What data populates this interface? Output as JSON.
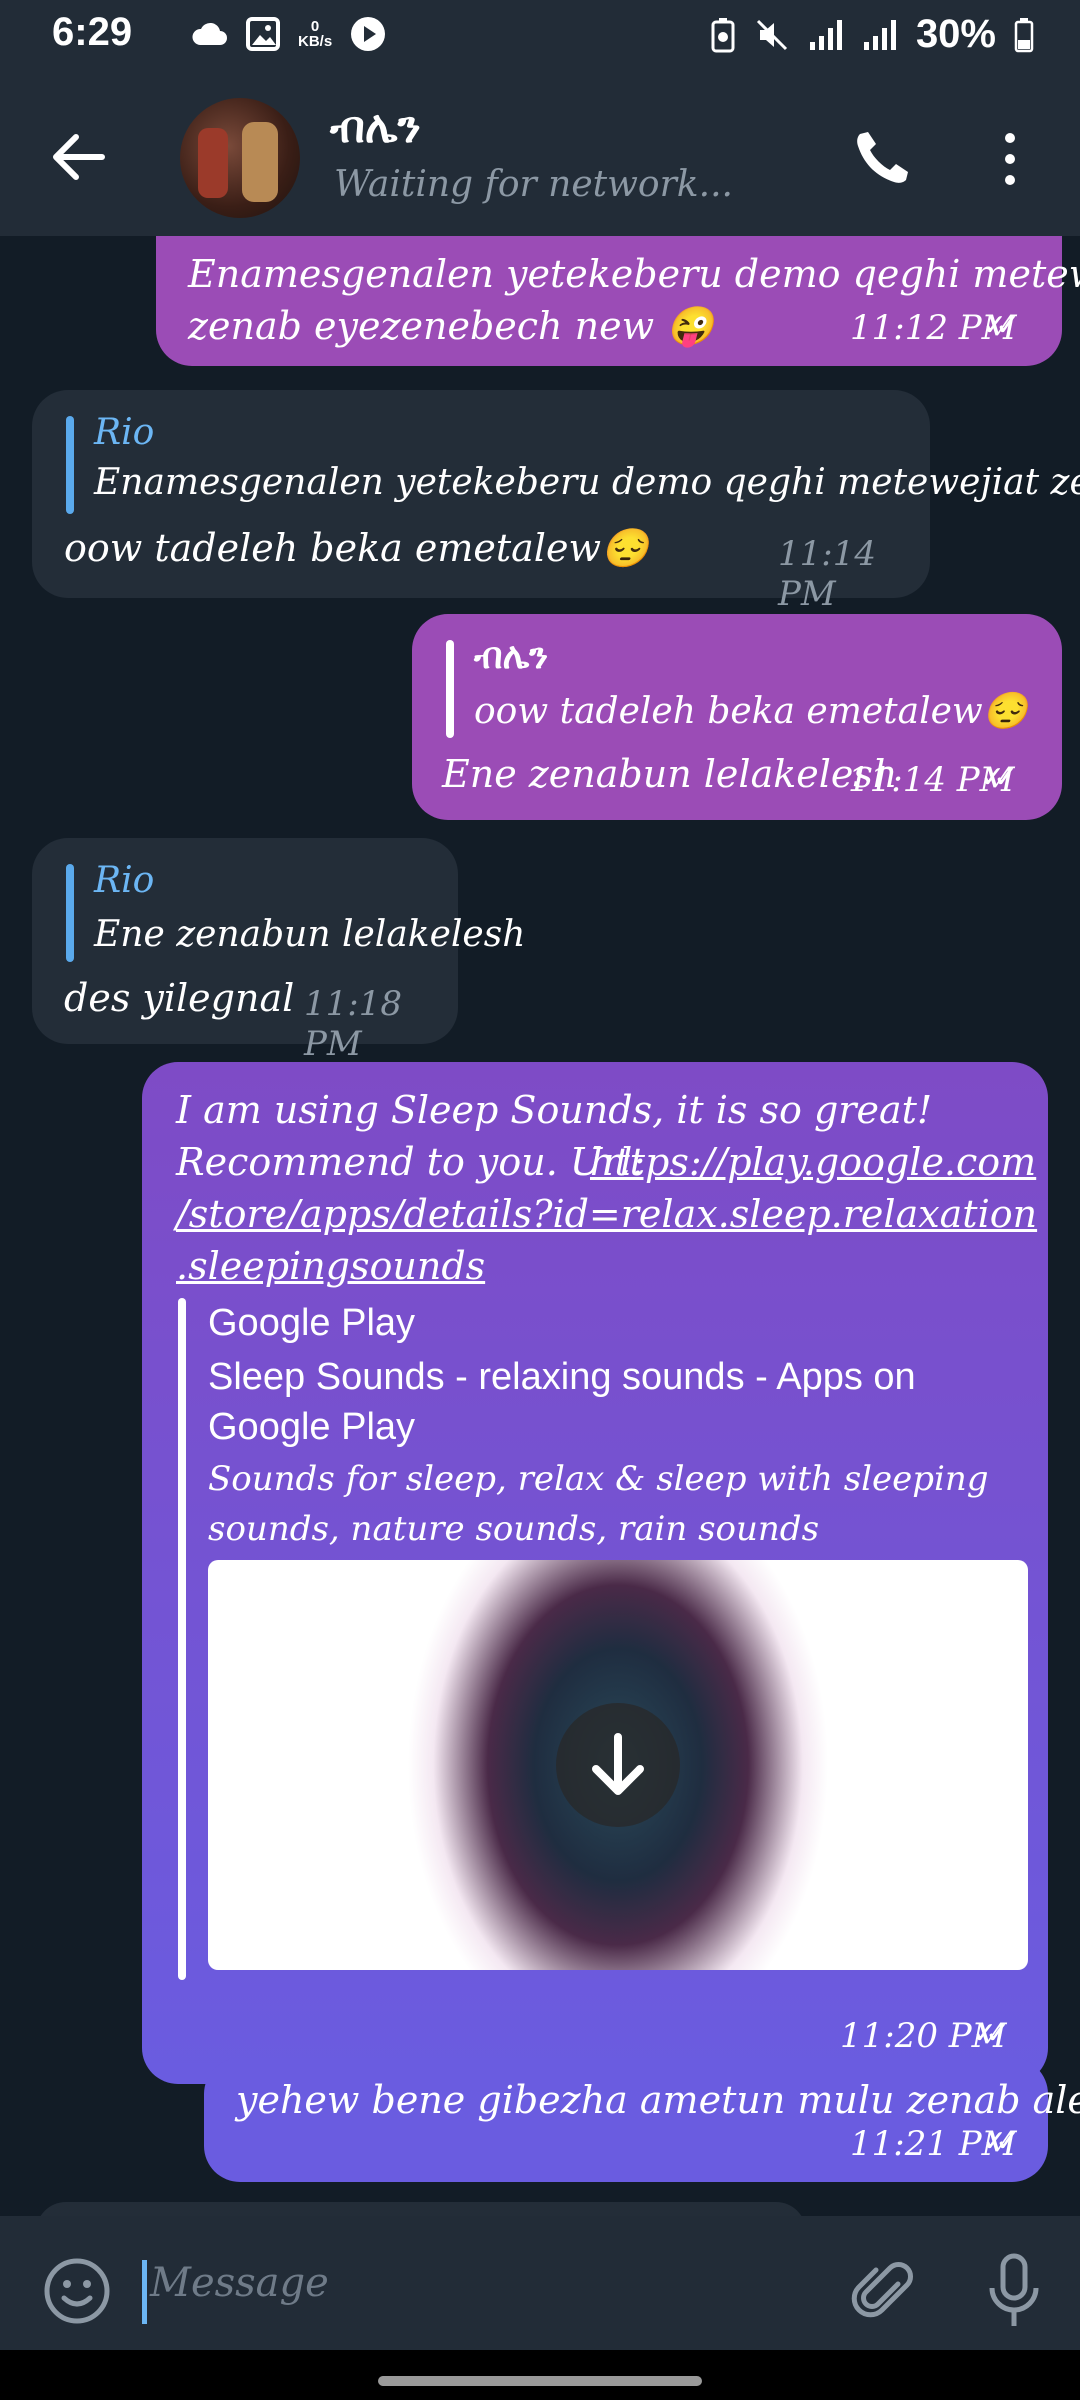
{
  "status_bar": {
    "time": "6:29",
    "net_speed_value": "0",
    "net_speed_unit": "KB/s",
    "battery": "30%"
  },
  "header": {
    "contact_name": "ብሌን",
    "status": "Waiting for network..."
  },
  "messages": [
    {
      "dir": "out",
      "text_line1": "Enamesgenalen yetekeberu demo qeghi metewejiat",
      "text_line2": "zenab eyezenebech new 😜",
      "time": "11:12 PM"
    },
    {
      "dir": "in",
      "reply_name": "Rio",
      "reply_text": "Enamesgenalen yetekeberu demo qeghi metewejiat zen...",
      "text": "oow tadeleh beka emetalew😔",
      "time": "11:14 PM"
    },
    {
      "dir": "out",
      "reply_name": "ብሌን",
      "reply_text": "oow tadeleh beka emetalew😔",
      "text": "Ene zenabun lelakelesh",
      "time": "11:14 PM"
    },
    {
      "dir": "in",
      "reply_name": "Rio",
      "reply_text": "Ene zenabun lelakelesh",
      "text": "des yilegnal",
      "time": "11:18 PM"
    },
    {
      "dir": "out",
      "text_line1": "I am using Sleep Sounds, it is so great!",
      "text_line2_prefix": "Recommend to you. Url: ",
      "url_line1": "https://play.google.com",
      "url_line2": "/store/apps/details?id=relax.sleep.relaxation",
      "url_line3": ".sleepingsounds",
      "preview_site": "Google Play",
      "preview_title": "Sleep Sounds - relaxing sounds - Apps on Google Play",
      "preview_desc": "Sounds for sleep, relax & sleep with sleeping sounds, nature sounds, rain sounds",
      "time": "11:20 PM"
    },
    {
      "dir": "out",
      "text": "yehew bene gibezha ametun mulu zenab alelesh",
      "time": "11:21 PM"
    }
  ],
  "input": {
    "placeholder": "Message"
  },
  "colors": {
    "background": "#121c26",
    "bar": "#222c37",
    "incoming": "#232d38",
    "outgoing_top": "#9b4cb6",
    "outgoing_bottom": "#6a5ce0",
    "accent": "#6cb6f4"
  }
}
